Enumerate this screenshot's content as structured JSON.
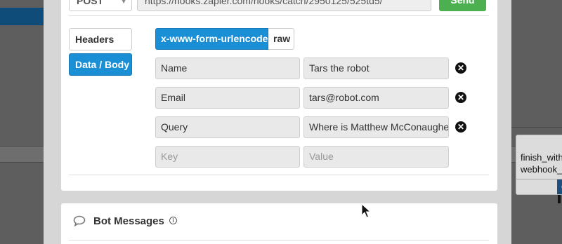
{
  "request": {
    "method": "POST",
    "url": "https://hooks.zapier.com/hooks/catch/2950125/525td5/",
    "send_label": "Send"
  },
  "tabs": {
    "headers": "Headers",
    "body": "Data / Body"
  },
  "encoding": {
    "urlencoded": "x-www-form-urlencoded",
    "raw": "raw"
  },
  "rows": [
    {
      "key": "Name",
      "value": "Tars the robot"
    },
    {
      "key": "Email",
      "value": "tars@robot.com"
    },
    {
      "key": "Query",
      "value": "Where is Matthew McConaughey?"
    }
  ],
  "new_row": {
    "key_placeholder": "Key",
    "value_placeholder": "Value"
  },
  "bot_messages": {
    "title": "Bot Messages"
  },
  "background_card": {
    "line1": "finish_with",
    "line2": "webhook_c"
  },
  "colors": {
    "primary": "#1a8fd6",
    "send": "#4caf50",
    "header_stripe": "#0f4c79"
  }
}
